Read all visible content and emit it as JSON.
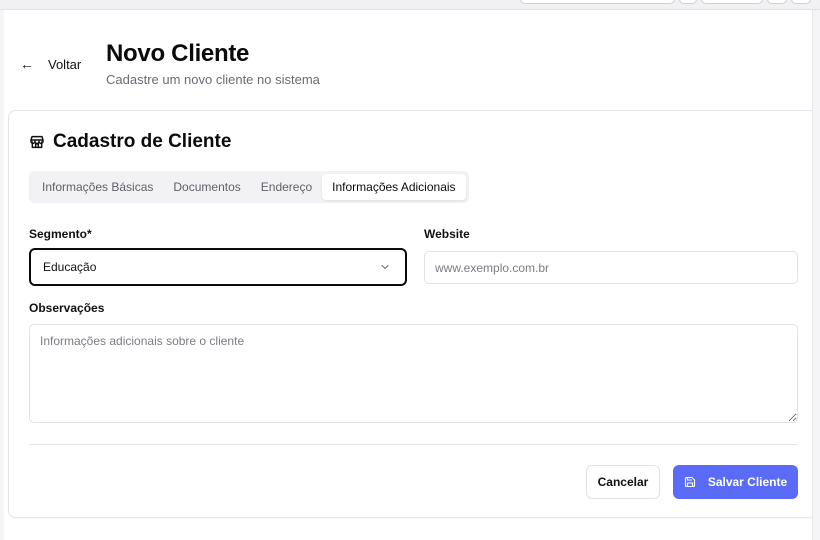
{
  "header": {
    "back_label": "Voltar",
    "title": "Novo Cliente",
    "subtitle": "Cadastre um novo cliente no sistema"
  },
  "card": {
    "icon": "store-icon",
    "title": "Cadastro de Cliente"
  },
  "tabs": [
    {
      "label": "Informações Básicas",
      "active": false
    },
    {
      "label": "Documentos",
      "active": false
    },
    {
      "label": "Endereço",
      "active": false
    },
    {
      "label": "Informações Adicionais",
      "active": true
    }
  ],
  "form": {
    "segment": {
      "label": "Segmento*",
      "value": "Educação"
    },
    "website": {
      "label": "Website",
      "placeholder": "www.exemplo.com.br",
      "value": ""
    },
    "notes": {
      "label": "Observações",
      "placeholder": "Informações adicionais sobre o cliente",
      "value": ""
    }
  },
  "actions": {
    "cancel_label": "Cancelar",
    "save_label": "Salvar Cliente",
    "save_icon": "save-icon"
  },
  "colors": {
    "accent": "#5a6cf7",
    "focus_border": "#0b0b0c"
  }
}
